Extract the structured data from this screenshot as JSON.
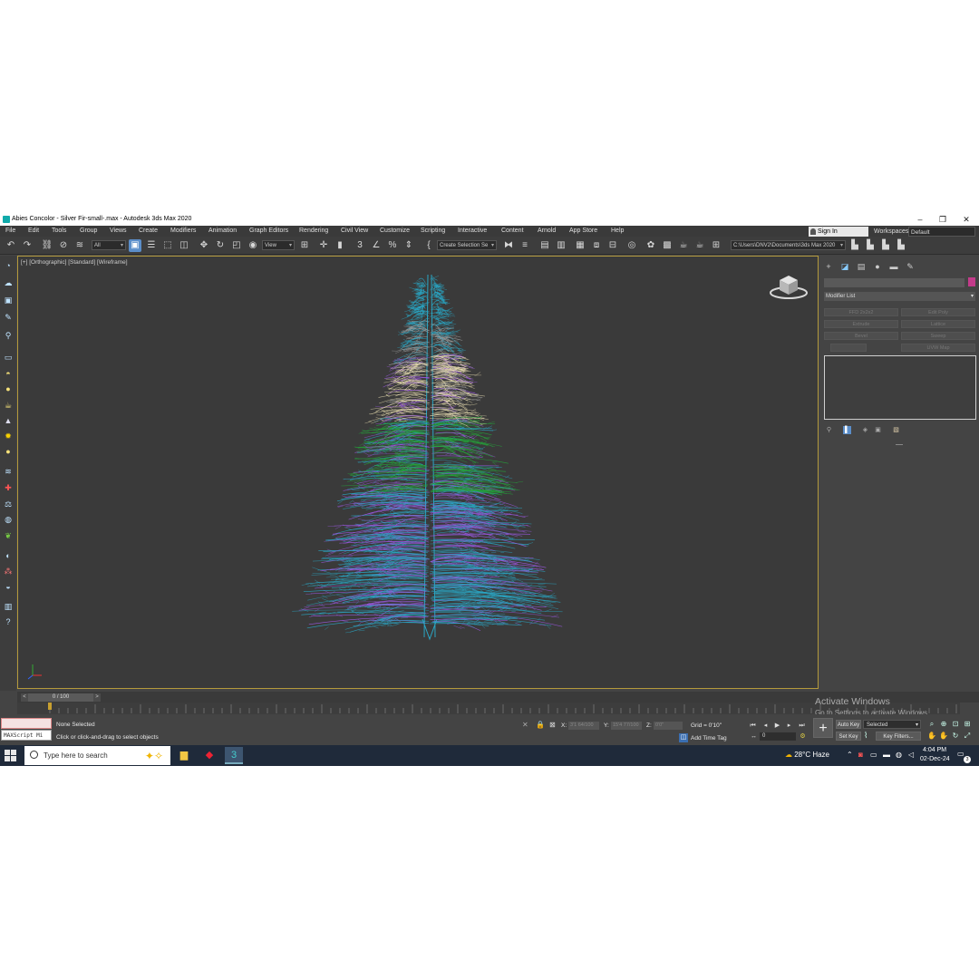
{
  "window": {
    "title": "Abies Concolor - Silver Fir-small-.max - Autodesk 3ds Max 2020",
    "minimize": "–",
    "restore": "❐",
    "close": "✕"
  },
  "menu": [
    "File",
    "Edit",
    "Tools",
    "Group",
    "Views",
    "Create",
    "Modifiers",
    "Animation",
    "Graph Editors",
    "Rendering",
    "Civil View",
    "Customize",
    "Scripting",
    "Interactive",
    "Content",
    "Arnold",
    "App Store",
    "Help"
  ],
  "signin": {
    "label": "Sign In"
  },
  "workspaces": {
    "label": "Workspaces:",
    "value": "Default"
  },
  "toolbar": {
    "filter_value": "All",
    "refcoord_value": "View",
    "selection_set": "Create Selection Se",
    "project_path": "C:\\Users\\DNV2\\Documents\\3ds Max 2020"
  },
  "viewport": {
    "label": "[+] [Orthographic] [Standard] [Wireframe]"
  },
  "command_panel": {
    "modifier_list": "Modifier List",
    "buttons": [
      "FFD 2x2x2",
      "Edit Poly",
      "Extrude",
      "Lattice",
      "Bevel",
      "Sweep",
      "",
      "UVW Map"
    ],
    "object_color": "#c33b8a"
  },
  "timeline": {
    "frame_display": "0 / 100",
    "prev": "<",
    "next": ">"
  },
  "status": {
    "maxscript_placeholder": "MAXScript Mi",
    "selection": "None Selected",
    "prompt": "Click or click-and-drag to select objects",
    "x_label": "X:",
    "x_value": "3'1 64/100",
    "y_label": "Y:",
    "y_value": "15'4 77/100",
    "z_label": "Z:",
    "z_value": "0'0\"",
    "grid": "Grid = 0'10\"",
    "add_time_tag": "Add Time Tag",
    "frame_field": "0",
    "auto_key": "Auto Key",
    "set_key": "Set Key",
    "key_mode": "Selected",
    "key_filters": "Key Filters..."
  },
  "watermark": {
    "line1": "Activate Windows",
    "line2": "Go to Settings to activate Windows."
  },
  "taskbar": {
    "search_placeholder": "Type here to search",
    "weather": "28°C  Haze",
    "time": "4:04 PM",
    "date": "02-Dec-24",
    "notif_count": "3"
  },
  "colors": {
    "tree_cyan": "#2aa6c4",
    "tree_purple": "#9a58e0",
    "tree_green": "#23a83a",
    "tree_cream": "#e8ddb0",
    "tree_gray": "#9a9a9a",
    "viewport_border": "#b49a3c"
  }
}
